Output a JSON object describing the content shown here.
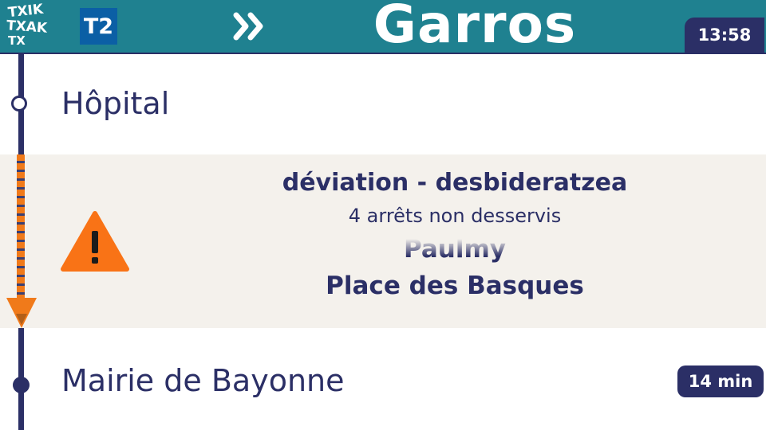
{
  "header": {
    "logo_lines": [
      "TXIK",
      "TXAK",
      "TX"
    ],
    "line_badge": "T2",
    "direction_icon": "double-chevron-right-icon",
    "destination": "Garros",
    "clock": "13:58",
    "colors": {
      "header_bg": "#1f8190",
      "line_badge_bg": "#0b5fa5",
      "navy": "#2b2f66"
    }
  },
  "stops": [
    {
      "name": "Hôpital",
      "marker": "open-circle"
    },
    {
      "name": "Mairie de Bayonne",
      "marker": "filled-circle",
      "eta": "14 min"
    }
  ],
  "deviation": {
    "icon": "warning-triangle-icon",
    "title": "déviation - desbideratzea",
    "subtitle": "4 arrêts non desservis",
    "skipped_stops": [
      "Paulmy",
      "Place des Basques"
    ],
    "colors": {
      "panel_bg": "#f4f1ec",
      "accent": "#f07a1a"
    }
  }
}
